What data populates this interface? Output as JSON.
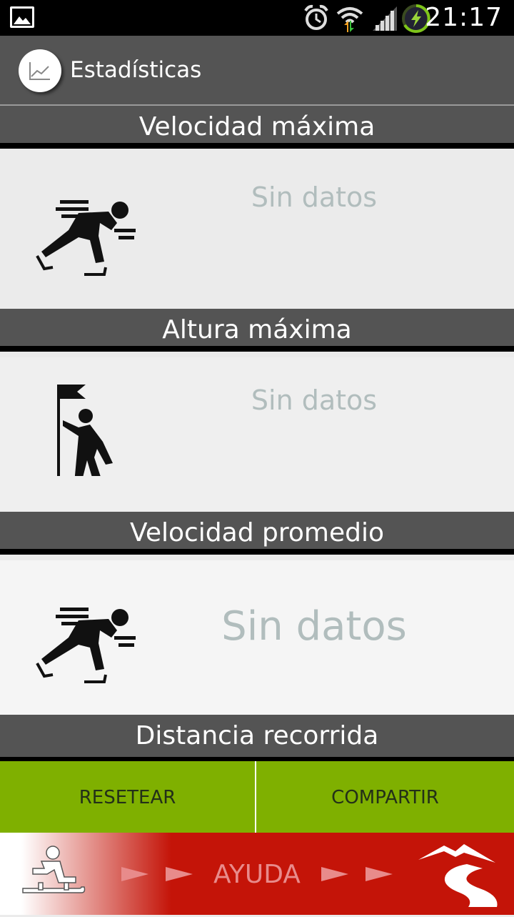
{
  "status_bar": {
    "time": "21:17",
    "icons": [
      "image-notification-icon",
      "alarm-icon",
      "wifi-icon",
      "signal-icon",
      "battery-charging-icon"
    ]
  },
  "action_bar": {
    "title": "Estadísticas",
    "logo_icon": "chart-line-icon"
  },
  "sections": [
    {
      "header": "Velocidad máxima",
      "value": "Sin datos",
      "icon": "speed-skater-icon"
    },
    {
      "header": "Altura máxima",
      "value": "Sin datos",
      "icon": "flag-climber-icon"
    },
    {
      "header": "Velocidad promedio",
      "value": "Sin datos",
      "icon": "speed-skater-icon"
    },
    {
      "header": "Distancia recorrida"
    }
  ],
  "buttons": {
    "reset": "RESETEAR",
    "share": "COMPARTIR"
  },
  "footer": {
    "help": "AYUDA",
    "left_icon": "sled-rider-icon",
    "right_icon": "mountain-road-icon"
  },
  "colors": {
    "header_bg": "#545454",
    "button_green": "#7fb000",
    "footer_red": "#c41408",
    "value_text": "#b1bdbd"
  }
}
